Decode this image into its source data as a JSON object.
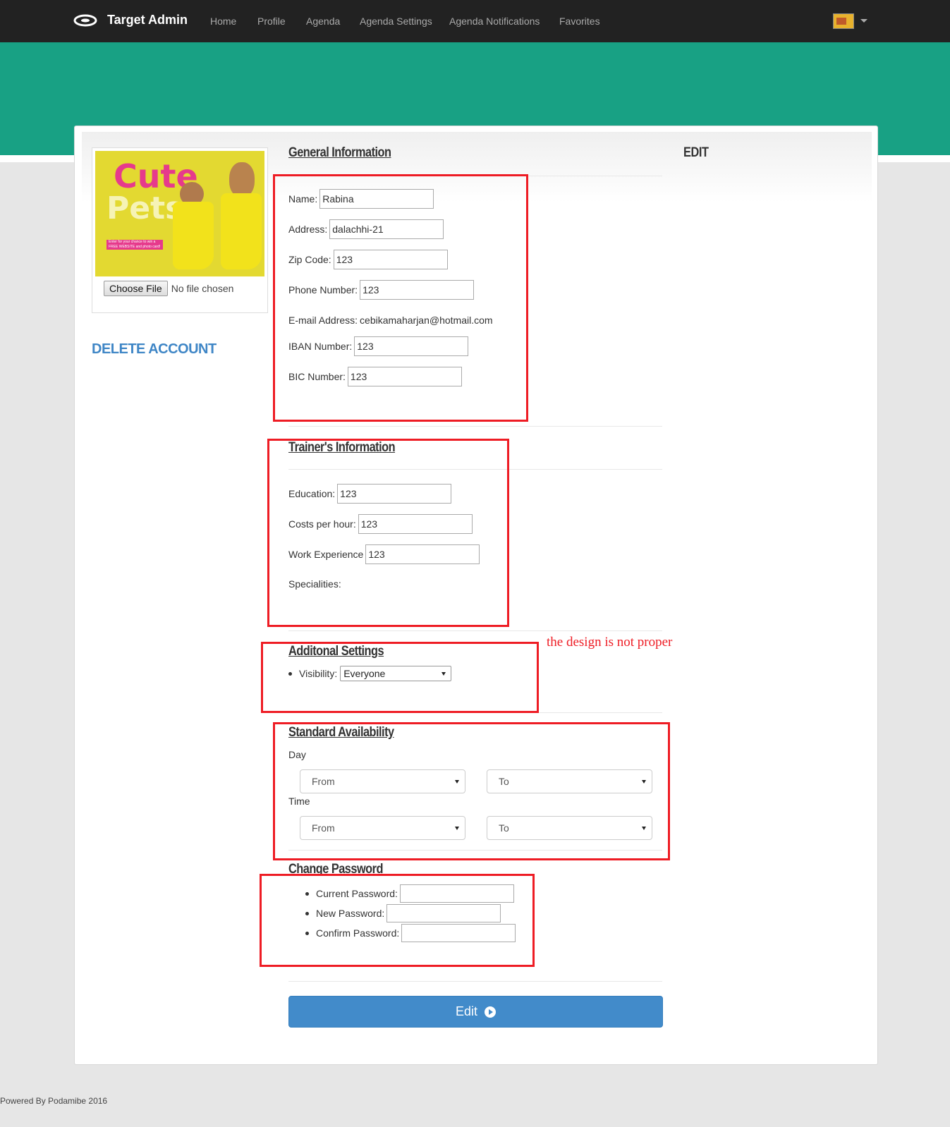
{
  "nav": {
    "brand": "Target Admin",
    "links": [
      "Home",
      "Profile",
      "Agenda",
      "Agenda Settings",
      "Agenda Notifications",
      "Favorites"
    ]
  },
  "sidebar": {
    "photo_title_line1": "Cute",
    "photo_title_line2": "Pets",
    "photo_promo": "Enter for your chance to win a FREE WEBSITE and photo card!",
    "choose_file_label": "Choose File",
    "file_status": "No file chosen",
    "delete_account": "DELETE ACCOUNT"
  },
  "edit_heading": "EDIT",
  "general": {
    "title": "General Information",
    "name_label": "Name:",
    "name_value": "Rabina",
    "address_label": "Address:",
    "address_value": "dalachhi-21",
    "zip_label": "Zip Code:",
    "zip_value": "123",
    "phone_label": "Phone Number:",
    "phone_value": "123",
    "email_label": "E-mail Address:",
    "email_value": "cebikamaharjan@hotmail.com",
    "iban_label": "IBAN Number:",
    "iban_value": "123",
    "bic_label": "BIC Number:",
    "bic_value": "123"
  },
  "trainer": {
    "title": "Trainer's Information",
    "education_label": "Education:",
    "education_value": "123",
    "costs_label": "Costs per hour:",
    "costs_value": "123",
    "experience_label": "Work Experience",
    "experience_value": "123",
    "specialities_label": "Specialities:"
  },
  "additional": {
    "title": "Additonal Settings",
    "visibility_label": "Visibility:",
    "visibility_value": "Everyone"
  },
  "annotation": "the design is not proper",
  "availability": {
    "title": "Standard Availability",
    "day_label": "Day",
    "time_label": "Time",
    "from": "From",
    "to": "To"
  },
  "password": {
    "title": "Change Password",
    "current_label": "Current Password:",
    "new_label": "New Password:",
    "confirm_label": "Confirm Password:"
  },
  "edit_button": "Edit",
  "footer": "Powered By Podamibe 2016",
  "colors": {
    "navbar": "#222222",
    "banner": "#18a184",
    "primary_button": "#428bca",
    "link": "#3f86c6",
    "annotation_red": "#ee1c24"
  }
}
